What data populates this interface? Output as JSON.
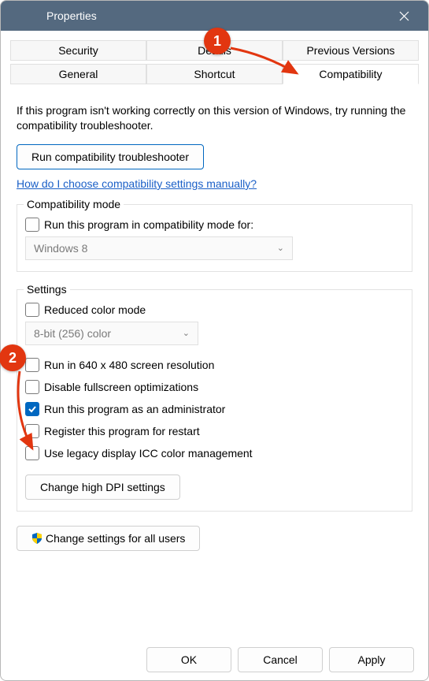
{
  "window": {
    "title": "Properties"
  },
  "tabs": {
    "row1": [
      "Security",
      "Details",
      "Previous Versions"
    ],
    "row2": [
      "General",
      "Shortcut",
      "Compatibility"
    ],
    "active": "Compatibility"
  },
  "desc": "If this program isn't working correctly on this version of Windows, try running the compatibility troubleshooter.",
  "run_troubleshooter": "Run compatibility troubleshooter",
  "manual_link": "How do I choose compatibility settings manually?",
  "compat_mode": {
    "legend": "Compatibility mode",
    "checkbox": "Run this program in compatibility mode for:",
    "select_value": "Windows 8"
  },
  "settings": {
    "legend": "Settings",
    "reduced_color": "Reduced color mode",
    "color_select": "8-bit (256) color",
    "run_640": "Run in 640 x 480 screen resolution",
    "disable_fullscreen": "Disable fullscreen optimizations",
    "run_admin": "Run this program as an administrator",
    "register_restart": "Register this program for restart",
    "legacy_icc": "Use legacy display ICC color management",
    "high_dpi": "Change high DPI settings"
  },
  "change_all_users": "Change settings for all users",
  "buttons": {
    "ok": "OK",
    "cancel": "Cancel",
    "apply": "Apply"
  },
  "annotations": {
    "step1": "1",
    "step2": "2"
  }
}
